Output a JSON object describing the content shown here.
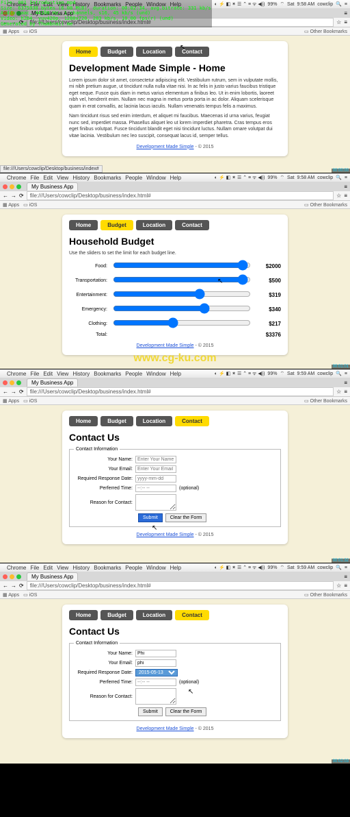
{
  "overlay": {
    "l1": "File: 001 Introduction.mp4",
    "l2": "Size: 6375938 bytes (6.08 MiB), duration: 00:02:34, avg.bitrate: 331 kb/s",
    "l3": "Audio: aac, 44100 Hz, 1 channels, s16, 45 kb/s (und)",
    "l4": "Video: h264, yuv420p, 1280x720, 283 kb/s, 10.00 fps(r) (und)",
    "l5": "Generated by Thumbnail me"
  },
  "menubar": {
    "apple": "",
    "items": [
      "Chrome",
      "File",
      "Edit",
      "View",
      "History",
      "Bookmarks",
      "People",
      "Window",
      "Help"
    ],
    "right_icons": "◐ ⚡ ◧ ✶ ☰ ⌃ ≡ ᯤ ◀))",
    "battery": "99%",
    "bt": "⌔",
    "user": "cowclip",
    "search": "🔍",
    "menu": "≡"
  },
  "times": [
    "9:58 AM",
    "9:58 AM",
    "9:59 AM",
    "9:59 AM"
  ],
  "days": "Sat",
  "chrome": {
    "tab_title": "My Business App",
    "addr": "file:///Users/cowclip/Desktop/business/index.html#",
    "back": "←",
    "fwd": "→",
    "reload": "⟳",
    "bm_apps": "Apps",
    "bm_ios": "iOS",
    "bm_other": "Other Bookmarks",
    "star": "☆",
    "menu": "≡"
  },
  "nav": {
    "home": "Home",
    "budget": "Budget",
    "location": "Location",
    "contact": "Contact"
  },
  "footer": {
    "link": "Development Made Simple",
    "copy": " - © 2015"
  },
  "home": {
    "title": "Development Made Simple - Home",
    "p1": "Lorem ipsum dolor sit amet, consectetur adipiscing elit. Vestibulum rutrum, sem in vulputate mollis, mi nibh pretium augue, ut tincidunt nulla nulla vitae nisi. In ac felis in justo varius faucibus tristique eget neque. Fusce quis diam in metus varius elementum a finibus leo. Ut in enim lobortis, laoreet nibh vel, hendrerit enim. Nullam nec magna in metus porta porta in ac dolor. Aliquam scelerisque quam in erat convallis, ac lacinia lacus iaculis. Nullam venenatis tempus felis a maximus.",
    "p2": "Nam tincidunt risus sed enim interdum, et aliquet mi faucibus. Maecenas id urna varius, feugiat nunc sed, imperdiet massa. Phasellus aliquet leo ut lorem imperdiet pharetra. Cras tempus eros eget finibus volutpat. Fusce tincidunt blandit eget nisi tincidunt luctus. Nullam ornare volutpat dui vitae lacinia. Vestibulum nec leo suscipit, consequat lacus id, semper tellus."
  },
  "budget": {
    "title": "Household Budget",
    "sub": "Use the sliders to set the limit for each budget line.",
    "rows": [
      {
        "label": "Food:",
        "value": "$2000"
      },
      {
        "label": "Transportation:",
        "value": "$500"
      },
      {
        "label": "Entertainment:",
        "value": "$319"
      },
      {
        "label": "Emergency:",
        "value": "$340"
      },
      {
        "label": "Clothing:",
        "value": "$217"
      }
    ],
    "total_label": "Total:",
    "total_value": "$3376"
  },
  "contact": {
    "title": "Contact Us",
    "legend": "Contact Information",
    "name_label": "Your Name:",
    "name_ph": "Enter Your Name",
    "email_label": "Your Email:",
    "email_ph": "Enter Your Email",
    "date_label": "Required Response Date:",
    "date_ph": "yyyy-mm-dd",
    "time_label": "Perferred Time:",
    "time_ph": "--:-- --",
    "optional": "(optional)",
    "reason_label": "Reason for Contact:",
    "submit": "Submit",
    "clear": "Clear the Form"
  },
  "contact2": {
    "name_val": "Phi",
    "email_val": "phi",
    "date_val": "2015-05-13"
  },
  "watermark": "www.cg-ku.com",
  "status_url": "file:///Users/cowclip/Desktop/business/index#",
  "timecodes": [
    "00:00:00",
    "00:01:01",
    "00:01:32",
    "00:02:03"
  ]
}
